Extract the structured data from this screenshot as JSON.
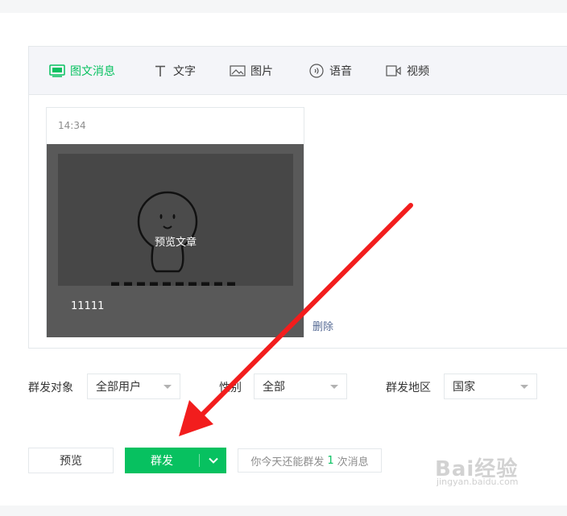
{
  "tabs": [
    {
      "label": "图文消息",
      "icon": "article-icon",
      "active": true
    },
    {
      "label": "文字",
      "icon": "text-icon",
      "active": false
    },
    {
      "label": "图片",
      "icon": "image-icon",
      "active": false
    },
    {
      "label": "语音",
      "icon": "voice-icon",
      "active": false
    },
    {
      "label": "视频",
      "icon": "video-icon",
      "active": false
    }
  ],
  "card": {
    "time": "14:34",
    "preview_label": "预览文章",
    "article_title": "11111",
    "delete_label": "删除"
  },
  "filters": {
    "target": {
      "label": "群发对象",
      "value": "全部用户"
    },
    "gender": {
      "label": "性别",
      "value": "全部"
    },
    "region": {
      "label": "群发地区",
      "value": "国家"
    }
  },
  "actions": {
    "preview_label": "预览",
    "send_label": "群发",
    "quota_prefix": "你今天还能群发",
    "quota_count": "1",
    "quota_suffix": "次消息"
  },
  "watermark": {
    "logo": "Bai经验",
    "site": "jingyan.baidu.com"
  },
  "colors": {
    "accent": "#07c160",
    "link": "#576b95",
    "annotation_arrow": "#f21d1d"
  }
}
